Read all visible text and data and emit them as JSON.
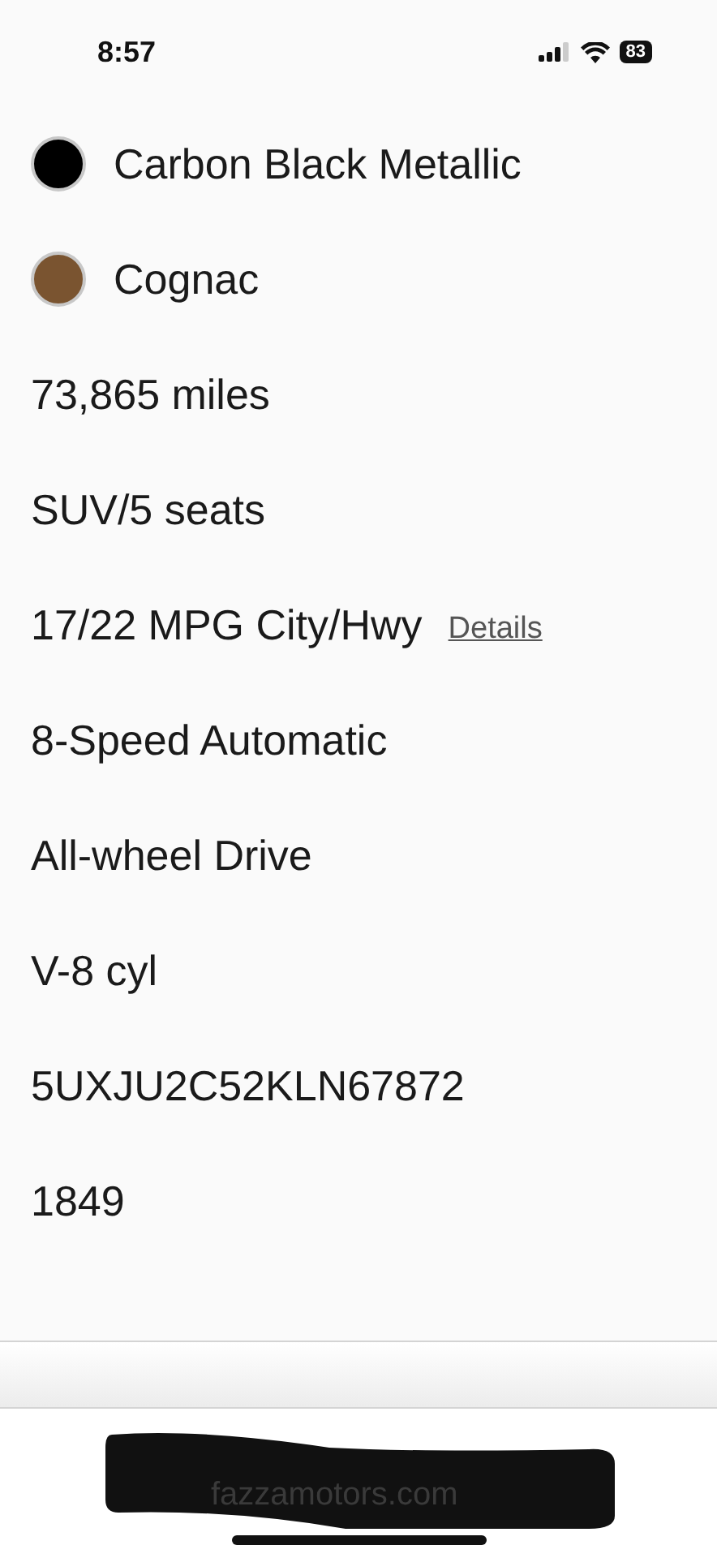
{
  "status_bar": {
    "time": "8:57",
    "battery": "83"
  },
  "specs": [
    {
      "kind": "swatch",
      "text": "Carbon Black Metallic",
      "color": "#000000"
    },
    {
      "kind": "swatch",
      "text": "Cognac",
      "color": "#7a5430"
    },
    {
      "kind": "plain",
      "text": "73,865 miles"
    },
    {
      "kind": "plain",
      "text": "SUV/5 seats"
    },
    {
      "kind": "link",
      "text": "17/22 MPG City/Hwy",
      "link": "Details"
    },
    {
      "kind": "plain",
      "text": "8-Speed Automatic"
    },
    {
      "kind": "plain",
      "text": "All-wheel Drive"
    },
    {
      "kind": "plain",
      "text": "V-8 cyl"
    },
    {
      "kind": "plain",
      "text": "5UXJU2C52KLN67872"
    },
    {
      "kind": "plain",
      "text": "1849"
    }
  ],
  "browser": {
    "url": "fazzamotors.com"
  }
}
